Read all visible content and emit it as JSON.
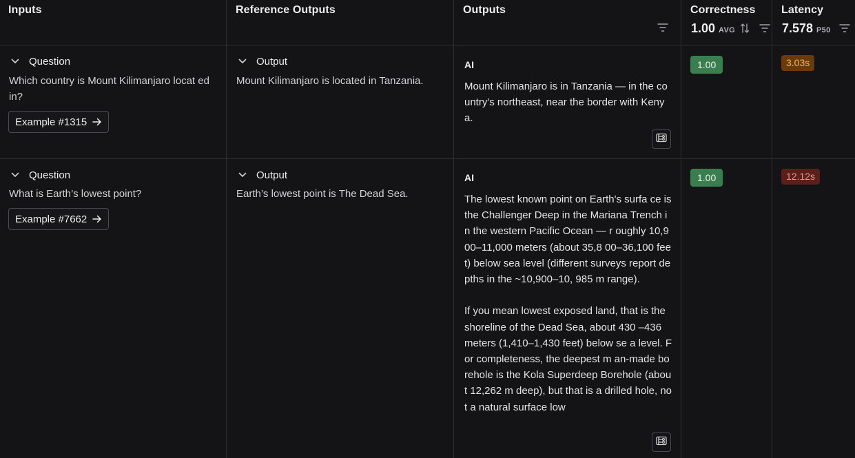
{
  "header": {
    "inputs": "Inputs",
    "reference_outputs": "Reference Outputs",
    "outputs": "Outputs",
    "correctness": {
      "title": "Correctness",
      "value": "1.00",
      "stat": "AVG"
    },
    "latency": {
      "title": "Latency",
      "value": "7.578",
      "stat": "P50"
    }
  },
  "rows": [
    {
      "input_section": "Question",
      "input_text": "Which country is Mount Kilimanjaro locat ed in?",
      "example": "Example #1315",
      "ref_section": "Output",
      "ref_text": "Mount Kilimanjaro is located in Tanzania.",
      "ai_label": "AI",
      "ai_text": "Mount Kilimanjaro is in Tanzania — in the country's northeast, near the border with Kenya.",
      "correctness": "1.00",
      "latency": "3.03s",
      "latency_color": "#f3b35a"
    },
    {
      "input_section": "Question",
      "input_text": "What is Earth’s lowest point?",
      "example": "Example #7662",
      "ref_section": "Output",
      "ref_text": "Earth’s lowest point is The Dead Sea.",
      "ai_label": "AI",
      "ai_text": "The lowest known point on Earth's surfa ce is the Challenger Deep in the Mariana Trench in the western Pacific Ocean — r oughly 10,900–11,000 meters (about 35,8 00–36,100 feet) below sea level (different surveys report depths in the ~10,900–10, 985 m range).\n\nIf you mean lowest exposed land, that is the shoreline of the Dead Sea, about 430 –436 meters (1,410–1,430 feet) below se a level. For completeness, the deepest m an-made borehole is the Kola Superdeep Borehole (about 12,262 m deep), but that is a drilled hole, not a natural surface low",
      "correctness": "1.00",
      "latency": "12.12s",
      "latency_color": "#f0958a"
    }
  ]
}
